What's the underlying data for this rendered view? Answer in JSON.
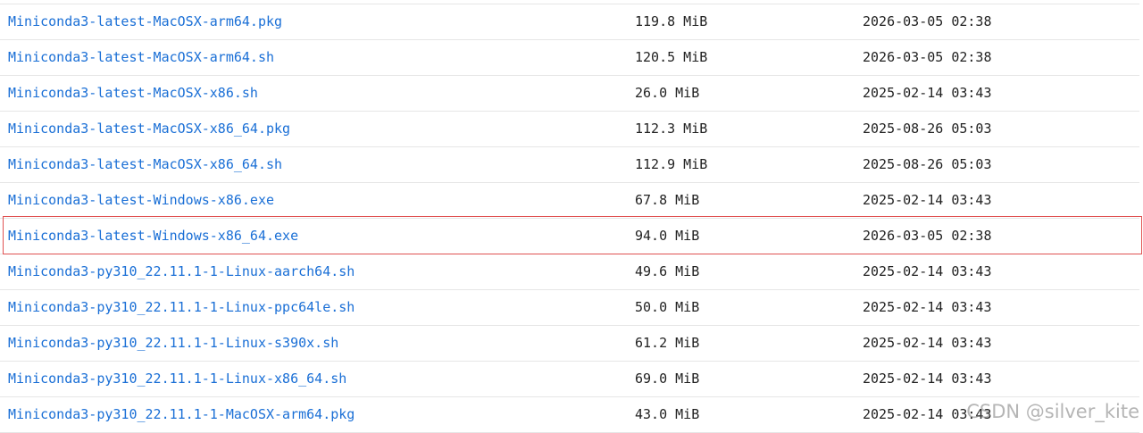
{
  "files": [
    {
      "name": "Miniconda3-latest-MacOSX-arm64.pkg",
      "size": "119.8 MiB",
      "date": "2026-03-05 02:38"
    },
    {
      "name": "Miniconda3-latest-MacOSX-arm64.sh",
      "size": "120.5 MiB",
      "date": "2026-03-05 02:38"
    },
    {
      "name": "Miniconda3-latest-MacOSX-x86.sh",
      "size": "26.0 MiB",
      "date": "2025-02-14 03:43"
    },
    {
      "name": "Miniconda3-latest-MacOSX-x86_64.pkg",
      "size": "112.3 MiB",
      "date": "2025-08-26 05:03"
    },
    {
      "name": "Miniconda3-latest-MacOSX-x86_64.sh",
      "size": "112.9 MiB",
      "date": "2025-08-26 05:03"
    },
    {
      "name": "Miniconda3-latest-Windows-x86.exe",
      "size": "67.8 MiB",
      "date": "2025-02-14 03:43"
    },
    {
      "name": "Miniconda3-latest-Windows-x86_64.exe",
      "size": "94.0 MiB",
      "date": "2026-03-05 02:38",
      "highlighted": true
    },
    {
      "name": "Miniconda3-py310_22.11.1-1-Linux-aarch64.sh",
      "size": "49.6 MiB",
      "date": "2025-02-14 03:43"
    },
    {
      "name": "Miniconda3-py310_22.11.1-1-Linux-ppc64le.sh",
      "size": "50.0 MiB",
      "date": "2025-02-14 03:43"
    },
    {
      "name": "Miniconda3-py310_22.11.1-1-Linux-s390x.sh",
      "size": "61.2 MiB",
      "date": "2025-02-14 03:43"
    },
    {
      "name": "Miniconda3-py310_22.11.1-1-Linux-x86_64.sh",
      "size": "69.0 MiB",
      "date": "2025-02-14 03:43"
    },
    {
      "name": "Miniconda3-py310_22.11.1-1-MacOSX-arm64.pkg",
      "size": "43.0 MiB",
      "date": "2025-02-14 03:43"
    }
  ],
  "colors": {
    "link": "#1a6fd6",
    "text": "#222222",
    "row_border": "#e6e6e6",
    "highlight_border": "#e05252"
  },
  "watermark": "CSDN @silver_kite"
}
